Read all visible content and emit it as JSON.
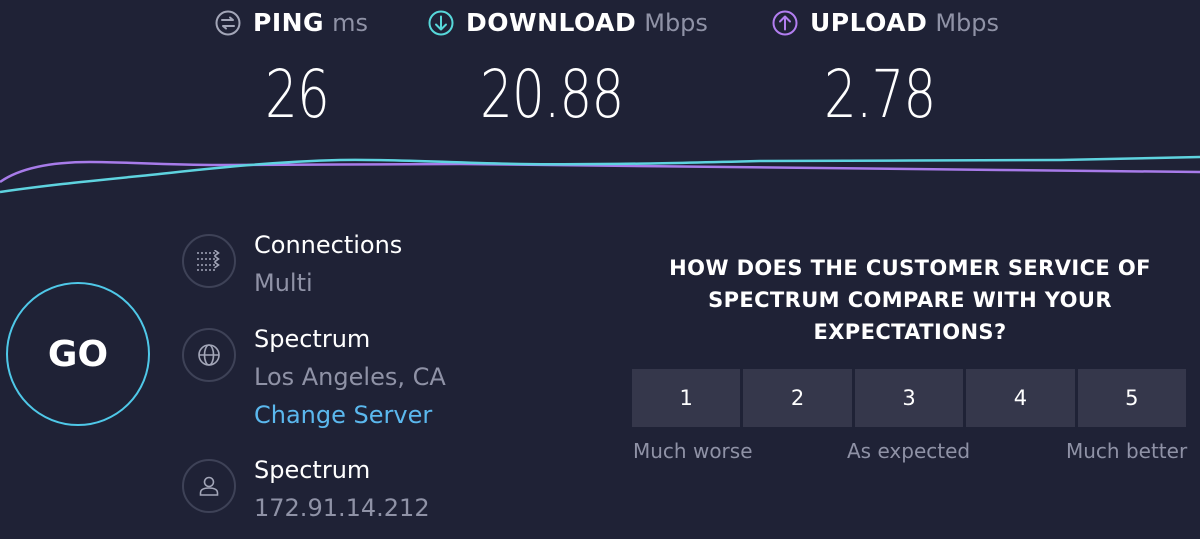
{
  "metrics": {
    "ping": {
      "label": "PING",
      "unit": "ms",
      "value": "26",
      "icon": "ping-icon",
      "color": "#a3a6b8"
    },
    "download": {
      "label": "DOWNLOAD",
      "unit": "Mbps",
      "value": "20.88",
      "icon": "download-arrow-icon",
      "color": "#57d8da"
    },
    "upload": {
      "label": "UPLOAD",
      "unit": "Mbps",
      "value": "2.78",
      "icon": "upload-arrow-icon",
      "color": "#b27ef0"
    }
  },
  "go_button": {
    "label": "GO",
    "color": "#4fc8e8"
  },
  "connections": {
    "title": "Connections",
    "value": "Multi",
    "icon": "connections-arrows-icon"
  },
  "server": {
    "title": "Spectrum",
    "location": "Los Angeles, CA",
    "change_link": "Change Server",
    "icon": "globe-icon"
  },
  "provider": {
    "title": "Spectrum",
    "ip": "172.91.14.212",
    "icon": "user-icon"
  },
  "survey": {
    "question": "HOW DOES THE CUSTOMER SERVICE OF SPECTRUM COMPARE WITH YOUR EXPECTATIONS?",
    "options": [
      "1",
      "2",
      "3",
      "4",
      "5"
    ],
    "scale_low": "Much worse",
    "scale_mid": "As expected",
    "scale_high": "Much better"
  },
  "colors": {
    "background": "#1f2236",
    "accent_link": "#5bb8ee",
    "muted_text": "#8f92a6"
  }
}
